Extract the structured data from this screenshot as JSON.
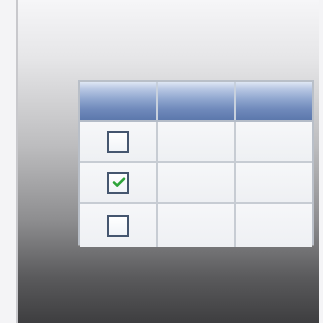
{
  "widget": {
    "type": "table-icon",
    "header_gradient": [
      "#dfe7f4",
      "#5c78ac"
    ],
    "accent_check_color": "#2ea43a"
  },
  "table": {
    "columns": [
      {
        "label": ""
      },
      {
        "label": ""
      },
      {
        "label": ""
      }
    ],
    "rows": [
      {
        "checkbox_state": "unchecked"
      },
      {
        "checkbox_state": "checked"
      },
      {
        "checkbox_state": "unchecked"
      }
    ]
  }
}
